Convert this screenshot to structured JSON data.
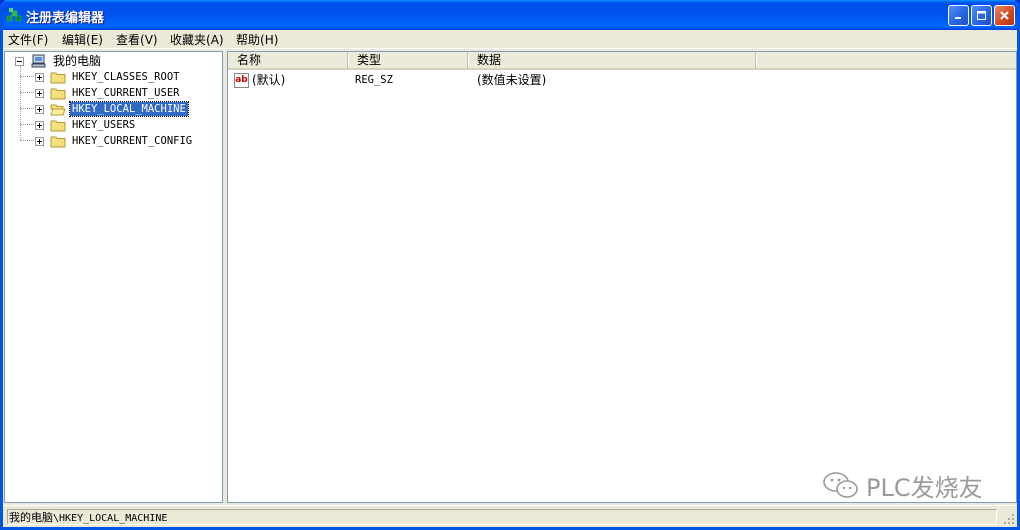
{
  "window": {
    "title": "注册表编辑器"
  },
  "menu": [
    {
      "label": "文件",
      "accel": "(F)"
    },
    {
      "label": "编辑",
      "accel": "(E)"
    },
    {
      "label": "查看",
      "accel": "(V)"
    },
    {
      "label": "收藏夹",
      "accel": "(A)"
    },
    {
      "label": "帮助",
      "accel": "(H)"
    }
  ],
  "tree": {
    "root_label": "我的电脑",
    "items": [
      {
        "label": "HKEY_CLASSES_ROOT"
      },
      {
        "label": "HKEY_CURRENT_USER"
      },
      {
        "label": "HKEY_LOCAL_MACHINE",
        "selected": true
      },
      {
        "label": "HKEY_USERS"
      },
      {
        "label": "HKEY_CURRENT_CONFIG"
      }
    ]
  },
  "list": {
    "columns": [
      "名称",
      "类型",
      "数据"
    ],
    "rows": [
      {
        "name": "(默认)",
        "type": "REG_SZ",
        "data": "(数值未设置)"
      }
    ]
  },
  "status": {
    "prefix": "我的电脑",
    "path": "\\HKEY_LOCAL_MACHINE"
  },
  "watermark": {
    "text": "PLC发烧友"
  },
  "colors": {
    "title_blue": "#0053ee",
    "selection": "#316ac5",
    "close_red": "#d2461c"
  }
}
